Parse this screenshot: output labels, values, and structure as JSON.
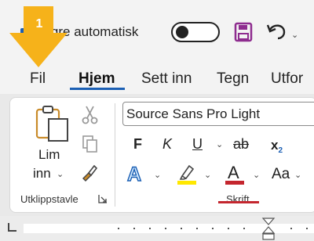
{
  "titlebar": {
    "autosave_label": "Lagre automatisk",
    "callout_number": "1"
  },
  "tabs": [
    "Fil",
    "Hjem",
    "Sett inn",
    "Tegn",
    "Utfor"
  ],
  "active_tab": "Hjem",
  "clipboard": {
    "paste_label_1": "Lim",
    "paste_label_2": "inn",
    "group_label": "Utklippstavle"
  },
  "font": {
    "font_name": "Source Sans Pro Light",
    "bold": "F",
    "italic": "K",
    "underline": "U",
    "strike": "ab",
    "subscript": "x",
    "subscript_sub": "2",
    "change_case": "Aa",
    "group_label": "Skrift"
  },
  "colors": {
    "callout": "#f6b21a",
    "accent": "#1b5fb4",
    "font_color": "#c4262e",
    "highlight": "#ffe800",
    "save": "#8e2c8f"
  }
}
